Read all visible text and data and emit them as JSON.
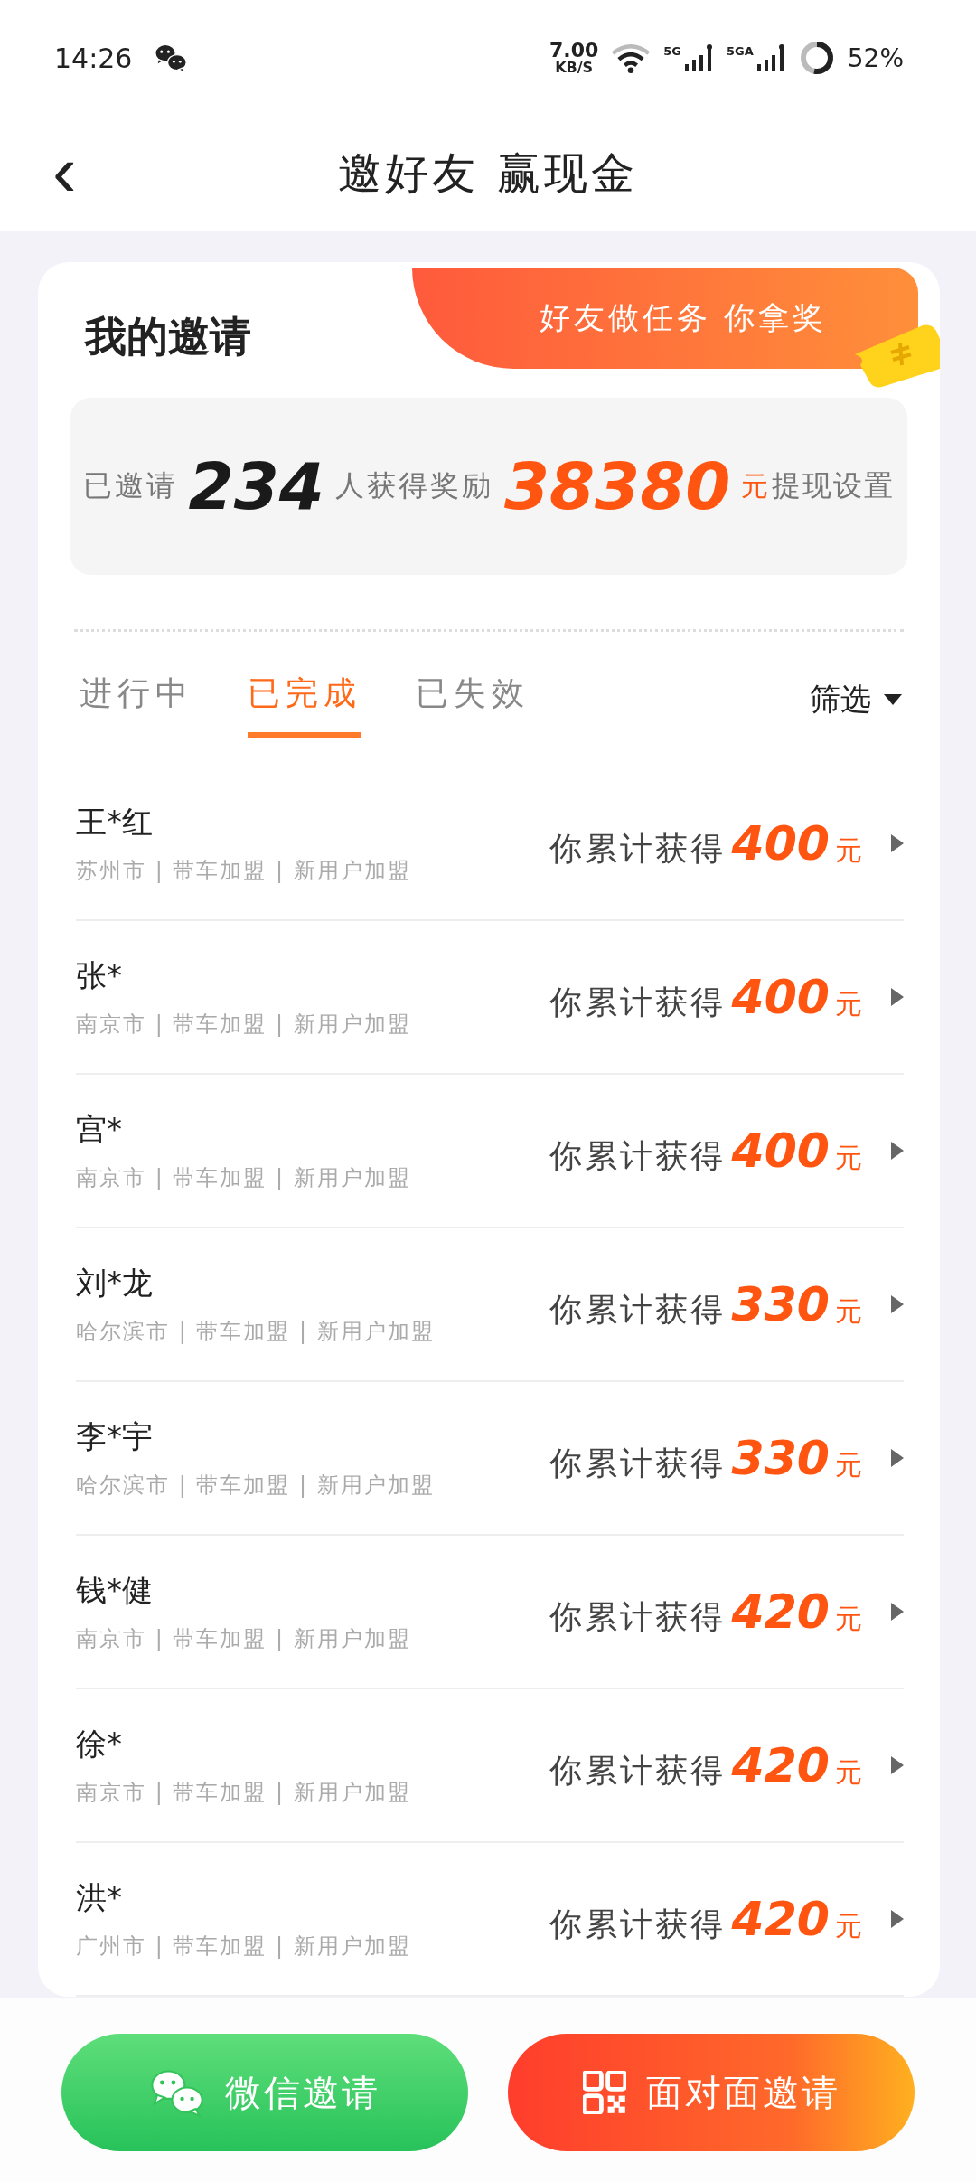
{
  "status_bar": {
    "time": "14:26",
    "speed": "7.00",
    "speed_unit": "KB/S",
    "sim1": "5G",
    "sim2": "5GA",
    "battery": "52%"
  },
  "header": {
    "back": "‹",
    "title": "邀好友 赢现金"
  },
  "card": {
    "title": "我的邀请",
    "banner": "好友做任务 你拿奖",
    "stats": {
      "invited_label": "已邀请",
      "invited": "234",
      "reward_label": "人获得奖励",
      "reward": "38380",
      "unit": "元",
      "settings": "提现设置"
    }
  },
  "tabs": [
    {
      "label": "进行中",
      "selected": false
    },
    {
      "label": "已完成",
      "selected": true
    },
    {
      "label": "已失效",
      "selected": false
    }
  ],
  "filter": "筛选",
  "rows": [
    {
      "name": "王*红",
      "details": "苏州市 | 带车加盟 | 新用户加盟",
      "label": "你累计获得",
      "amount": "400",
      "unit": "元"
    },
    {
      "name": "张*",
      "details": "南京市 | 带车加盟 | 新用户加盟",
      "label": "你累计获得",
      "amount": "400",
      "unit": "元"
    },
    {
      "name": "宫*",
      "details": "南京市 | 带车加盟 | 新用户加盟",
      "label": "你累计获得",
      "amount": "400",
      "unit": "元"
    },
    {
      "name": "刘*龙",
      "details": "哈尔滨市 | 带车加盟 | 新用户加盟",
      "label": "你累计获得",
      "amount": "330",
      "unit": "元"
    },
    {
      "name": "李*宇",
      "details": "哈尔滨市 | 带车加盟 | 新用户加盟",
      "label": "你累计获得",
      "amount": "330",
      "unit": "元"
    },
    {
      "name": "钱*健",
      "details": "南京市 | 带车加盟 | 新用户加盟",
      "label": "你累计获得",
      "amount": "420",
      "unit": "元"
    },
    {
      "name": "徐*",
      "details": "南京市 | 带车加盟 | 新用户加盟",
      "label": "你累计获得",
      "amount": "420",
      "unit": "元"
    },
    {
      "name": "洪*",
      "details": "广州市 | 带车加盟 | 新用户加盟",
      "label": "你累计获得",
      "amount": "420",
      "unit": "元"
    }
  ],
  "buttons": [
    {
      "kind": "wechat",
      "label": "微信邀请"
    },
    {
      "kind": "qr",
      "label": "面对面邀请"
    }
  ]
}
